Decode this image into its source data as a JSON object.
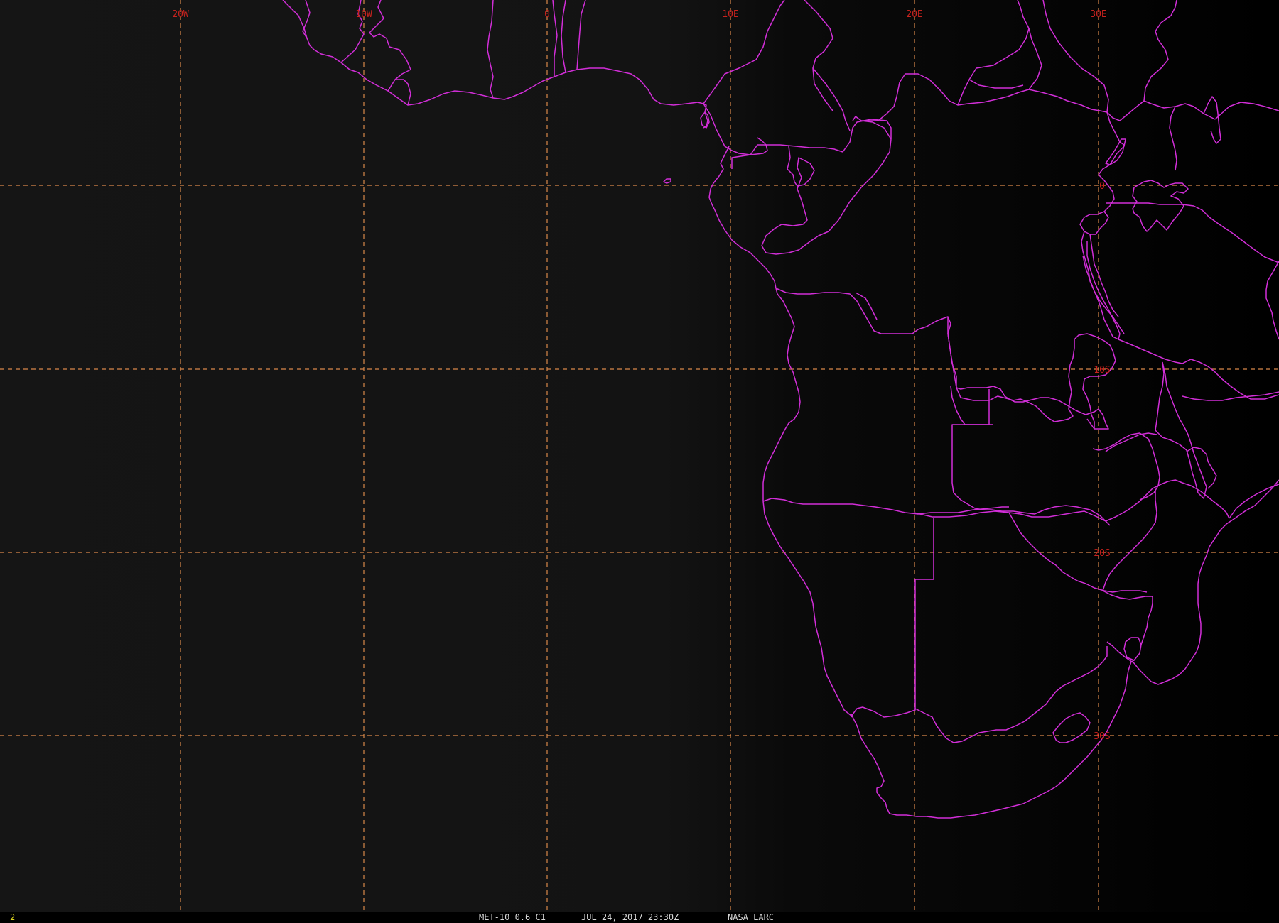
{
  "image": {
    "title": "",
    "sensor_label": "MET-10 0.6 C1",
    "datetime_label": "JUL 24, 2017 23:30Z",
    "producer_label": "NASA LARC",
    "frame_number": "2"
  },
  "map": {
    "projection": "geostationary satellite view",
    "region": "Southern and Central Africa / South Atlantic",
    "longitude_labels": [
      "20W",
      "10W",
      "0",
      "10E",
      "20E",
      "30E"
    ],
    "latitude_labels": [
      "0",
      "10S",
      "20S",
      "30S"
    ],
    "colors": {
      "background": "#000000",
      "ocean_tint": "#141414",
      "coastline": "#d22ed8",
      "graticule": "#d9884a",
      "graticule_labels": "#c8231e",
      "frame_number": "#e0d820",
      "status_text": "#d9d9d9"
    }
  }
}
